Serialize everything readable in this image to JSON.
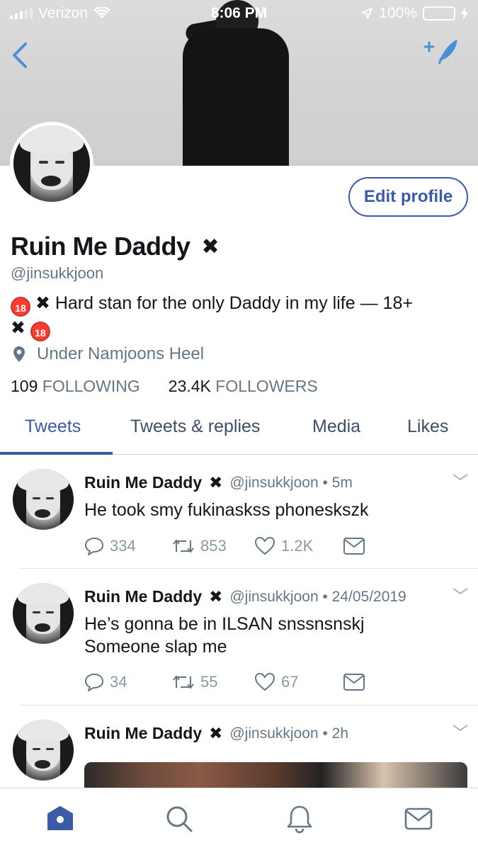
{
  "status_bar": {
    "carrier": "Verizon",
    "time": "8:06 PM",
    "battery": "100%"
  },
  "profile": {
    "edit_label": "Edit profile",
    "name": "Ruin Me Daddy",
    "name_mark": "✖",
    "handle": "@jinsukkjoon",
    "bio_emoji": "🔞",
    "bio_text": " ✖ Hard stan for the only Daddy in my life — 18+",
    "bio_line2": "✖",
    "location": "Under Namjoons Heel",
    "following_count": "109",
    "following_label": "FOLLOWING",
    "followers_count": "23.4K",
    "followers_label": "FOLLOWERS"
  },
  "tabs": [
    {
      "label": "Tweets",
      "active": true
    },
    {
      "label": "Tweets & replies",
      "active": false
    },
    {
      "label": "Media",
      "active": false
    },
    {
      "label": "Likes",
      "active": false
    }
  ],
  "tweets": [
    {
      "name": "Ruin Me Daddy",
      "mark": "✖",
      "handle_time": "@jinsukkjoon • 5m",
      "text": "He took smy fukinaskss phoneskszk",
      "replies": "334",
      "retweets": "853",
      "likes": "1.2K"
    },
    {
      "name": "Ruin Me Daddy",
      "mark": "✖",
      "handle_time": "@jinsukkjoon • 24/05/2019",
      "text": "He’s gonna be in ILSAN snssnsnskj Someone slap me",
      "replies": "34",
      "retweets": "55",
      "likes": "67"
    },
    {
      "name": "Ruin Me Daddy",
      "mark": "✖",
      "handle_time": "@jinsukkjoon • 2h",
      "text": ""
    }
  ],
  "colors": {
    "accent": "#3b5ba9",
    "muted": "#657786",
    "battery": "#4cd964"
  },
  "bottom_bar": [
    "home-icon",
    "search-icon",
    "bell-icon",
    "mail-icon"
  ]
}
